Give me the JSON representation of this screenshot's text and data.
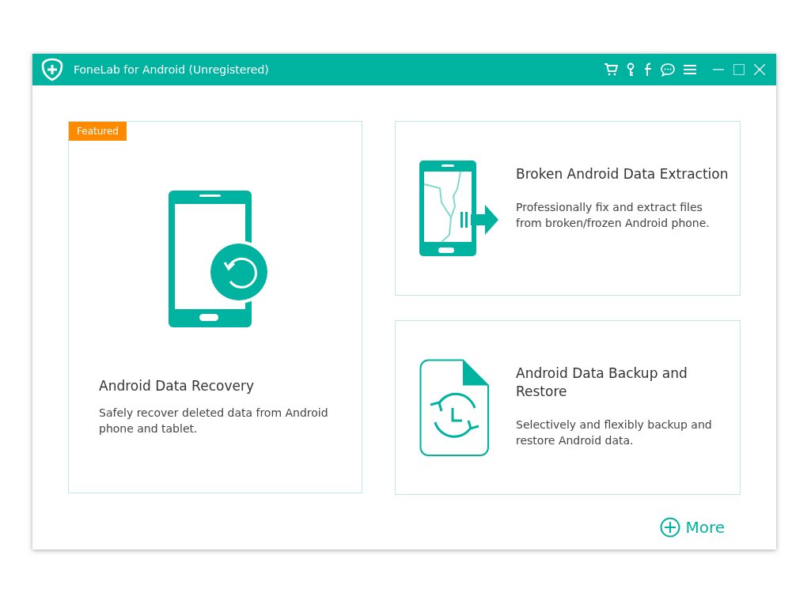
{
  "window": {
    "title": "FoneLab for Android (Unregistered)"
  },
  "cards": [
    {
      "kind": "recovery",
      "badge": "Featured",
      "title": "Android Data Recovery",
      "description": "Safely recover deleted data from Android phone and tablet."
    },
    {
      "kind": "broken",
      "title": "Broken Android Data Extraction",
      "description": "Professionally fix and extract files from broken/frozen Android phone."
    },
    {
      "kind": "backup",
      "title": "Android Data Backup and Restore",
      "description": "Selectively and flexibly backup and restore Android data."
    }
  ],
  "more_button": {
    "label": "More"
  }
}
